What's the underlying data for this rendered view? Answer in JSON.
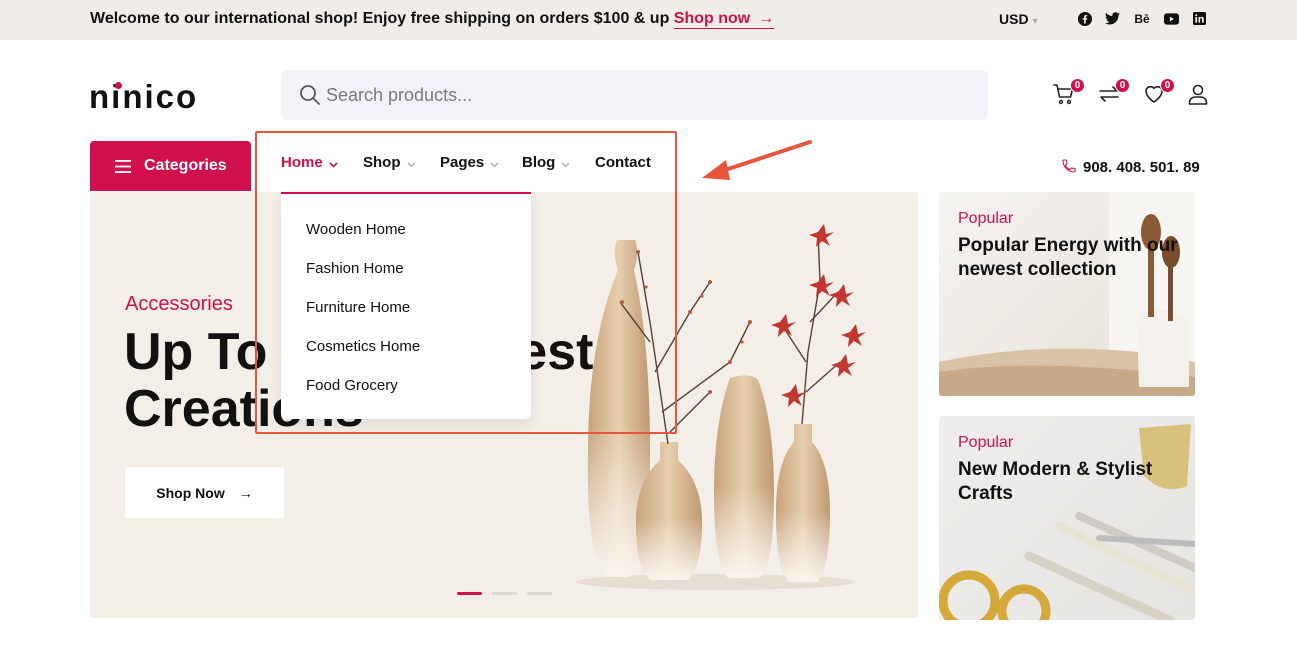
{
  "topbar": {
    "welcome_text": "Welcome to our international shop! Enjoy free shipping on orders $100 & up",
    "shop_now_label": "Shop now",
    "shop_now_arrow": "→",
    "currency": "USD",
    "socials": [
      "facebook-icon",
      "twitter-icon",
      "behance-icon",
      "youtube-icon",
      "linkedin-icon"
    ],
    "behance_label": "Bē"
  },
  "header": {
    "logo": "ninico",
    "search_placeholder": "Search products...",
    "cart_count": "0",
    "compare_count": "0",
    "wishlist_count": "0"
  },
  "nav": {
    "categories_label": "Categories",
    "items": [
      {
        "label": "Home",
        "active": true
      },
      {
        "label": "Shop"
      },
      {
        "label": "Pages"
      },
      {
        "label": "Blog"
      },
      {
        "label": "Contact"
      }
    ],
    "phone": "908. 408. 501. 89"
  },
  "dropdown": {
    "items": [
      "Wooden Home",
      "Fashion Home",
      "Furniture Home",
      "Cosmetics Home",
      "Food Grocery"
    ]
  },
  "hero": {
    "subtitle": "Accessories",
    "title_line1": "Up To",
    "title_line1_end": "rest",
    "title_line2": "Creations",
    "button_label": "Shop Now",
    "button_arrow": "→",
    "slides": 3,
    "active_slide": 1
  },
  "promos": [
    {
      "tag": "Popular",
      "title": "Popular Energy with our newest collection"
    },
    {
      "tag": "Popular",
      "title": "New Modern & Stylist Crafts"
    }
  ],
  "colors": {
    "accent": "#d0104c",
    "topbar_bg": "#f0ede8",
    "hero_bg": "#f4eee9",
    "annotation": "#e8553a"
  }
}
